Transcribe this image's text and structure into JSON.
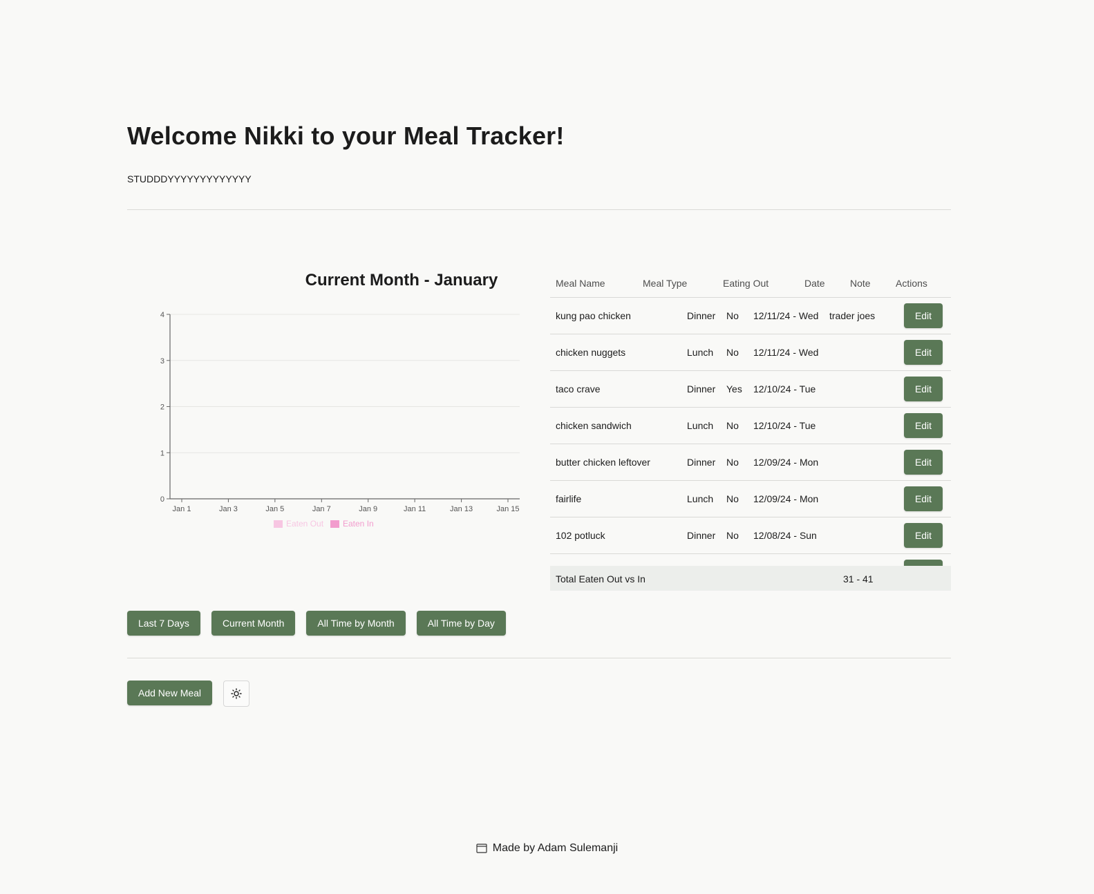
{
  "header": {
    "title": "Welcome Nikki to your Meal Tracker!",
    "subtitle": "STUDDDYYYYYYYYYYYYY"
  },
  "chart_data": {
    "type": "bar",
    "title": "Current Month - January",
    "categories": [
      "Jan 1",
      "Jan 3",
      "Jan 5",
      "Jan 7",
      "Jan 9",
      "Jan 11",
      "Jan 13",
      "Jan 15"
    ],
    "ylim": [
      0,
      4
    ],
    "yticks": [
      0,
      1,
      2,
      3,
      4
    ],
    "grid": true,
    "legend_position": "bottom",
    "series": [
      {
        "name": "Eaten Out",
        "color": "#f7c6e2",
        "values": [
          0,
          0,
          0,
          0,
          0,
          0,
          0,
          0
        ]
      },
      {
        "name": "Eaten In",
        "color": "#f29ccd",
        "values": [
          0,
          0,
          0,
          0,
          0,
          0,
          0,
          0
        ]
      }
    ]
  },
  "table": {
    "headers": {
      "meal_name": "Meal Name",
      "meal_type": "Meal Type",
      "eating_out": "Eating Out",
      "date": "Date",
      "note": "Note",
      "actions": "Actions"
    },
    "rows": [
      {
        "name": "kung pao chicken",
        "type": "Dinner",
        "out": "No",
        "date": "12/11/24 - Wed",
        "note": "trader joes",
        "action": "Edit"
      },
      {
        "name": "chicken nuggets",
        "type": "Lunch",
        "out": "No",
        "date": "12/11/24 - Wed",
        "note": "",
        "action": "Edit"
      },
      {
        "name": "taco crave",
        "type": "Dinner",
        "out": "Yes",
        "date": "12/10/24 - Tue",
        "note": "",
        "action": "Edit"
      },
      {
        "name": "chicken sandwich",
        "type": "Lunch",
        "out": "No",
        "date": "12/10/24 - Tue",
        "note": "",
        "action": "Edit"
      },
      {
        "name": "butter chicken leftover",
        "type": "Dinner",
        "out": "No",
        "date": "12/09/24 - Mon",
        "note": "",
        "action": "Edit"
      },
      {
        "name": "fairlife",
        "type": "Lunch",
        "out": "No",
        "date": "12/09/24 - Mon",
        "note": "",
        "action": "Edit"
      },
      {
        "name": "102 potluck",
        "type": "Dinner",
        "out": "No",
        "date": "12/08/24 - Sun",
        "note": "",
        "action": "Edit"
      }
    ],
    "footer": {
      "label": "Total Eaten Out vs In",
      "value": "31 - 41"
    }
  },
  "view_buttons": {
    "last7": "Last 7 Days",
    "current_month": "Current Month",
    "all_time_month": "All Time by Month",
    "all_time_day": "All Time by Day"
  },
  "actions": {
    "add_meal": "Add New Meal",
    "theme_icon": "sun-icon"
  },
  "footer": {
    "icon": "window-icon",
    "text": "Made by Adam Sulemanji"
  },
  "colors": {
    "accent": "#5a7856",
    "background": "#f9f9f7"
  }
}
